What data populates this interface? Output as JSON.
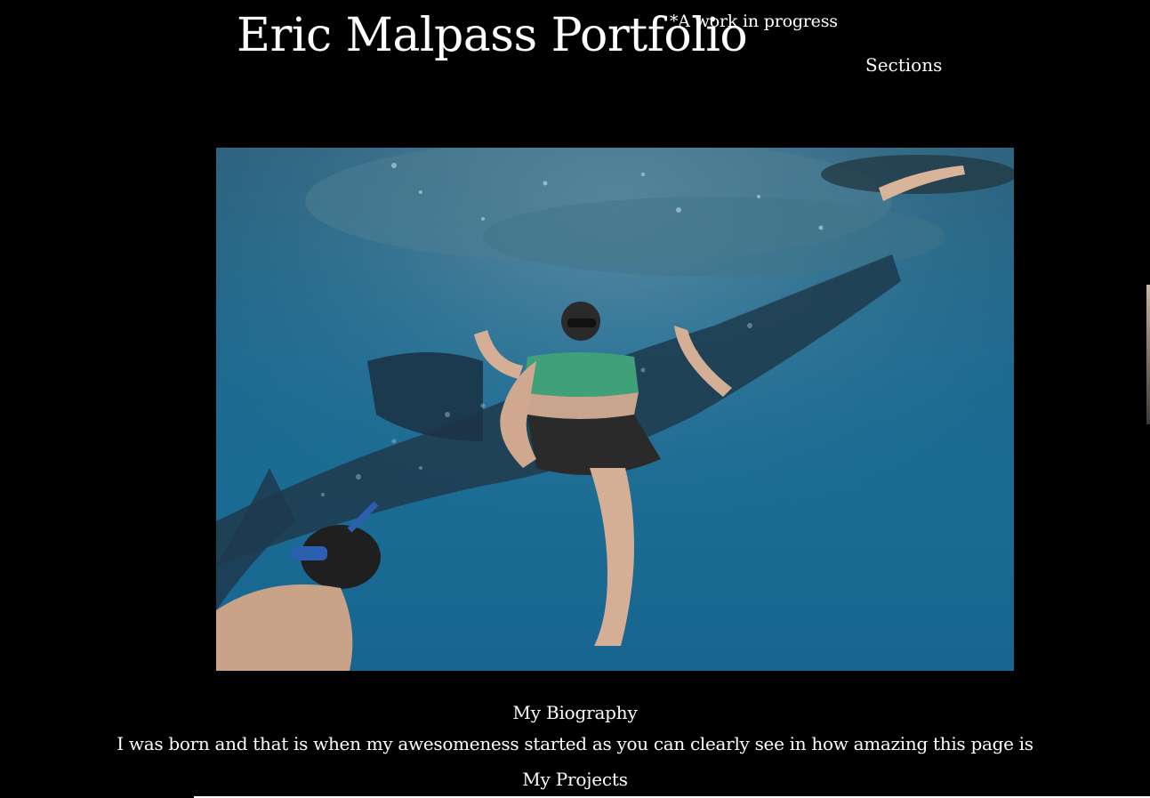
{
  "header": {
    "title": "Eric Malpass Portfolio",
    "note": "*A work in progress",
    "nav_label": "Sections"
  },
  "hero": {
    "alt": "Underwater photo of snorkelers swimming beside a whale shark"
  },
  "biography": {
    "heading": "My Biography",
    "text": "I was born and that is when my awesomeness started as you can clearly see in how amazing this page is"
  },
  "projects": {
    "heading": "My Projects"
  },
  "colors": {
    "background": "#000000",
    "text": "#ffffff",
    "water": "#1a6b94"
  }
}
